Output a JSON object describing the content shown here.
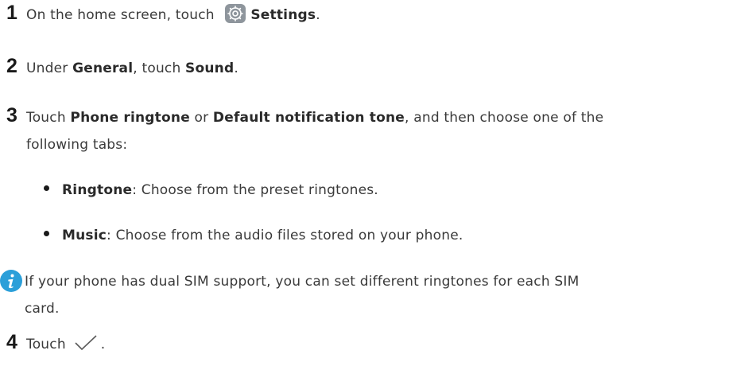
{
  "steps": [
    {
      "number": "1",
      "pre": "On the home screen, touch",
      "icon": "settings-gear-icon",
      "bold": "Settings",
      "post": "."
    },
    {
      "number": "2",
      "pre": "Under ",
      "bold1": "General",
      "mid": ", touch ",
      "bold2": "Sound",
      "post": "."
    },
    {
      "number": "3",
      "pre": "Touch ",
      "bold1": "Phone ringtone",
      "mid": " or ",
      "bold2": "Default notification tone",
      "post": ", and then choose one of the",
      "continuation": "following tabs:"
    },
    {
      "number": "4",
      "pre": "Touch",
      "icon": "checkmark-icon",
      "post": "."
    }
  ],
  "bullets": [
    {
      "bold": "Ringtone",
      "text": ": Choose from the preset ringtones."
    },
    {
      "bold": "Music",
      "text": ": Choose from the audio files stored on your phone."
    }
  ],
  "note": {
    "icon": "info-icon",
    "line1": "If your phone has dual SIM support, you can set different ringtones for each SIM",
    "line2": "card."
  },
  "colors": {
    "text": "#3a3a3a",
    "step_number": "#1a1a1a",
    "info_icon_bg": "#2b9fd9",
    "settings_icon_bg": "#8e959c"
  }
}
